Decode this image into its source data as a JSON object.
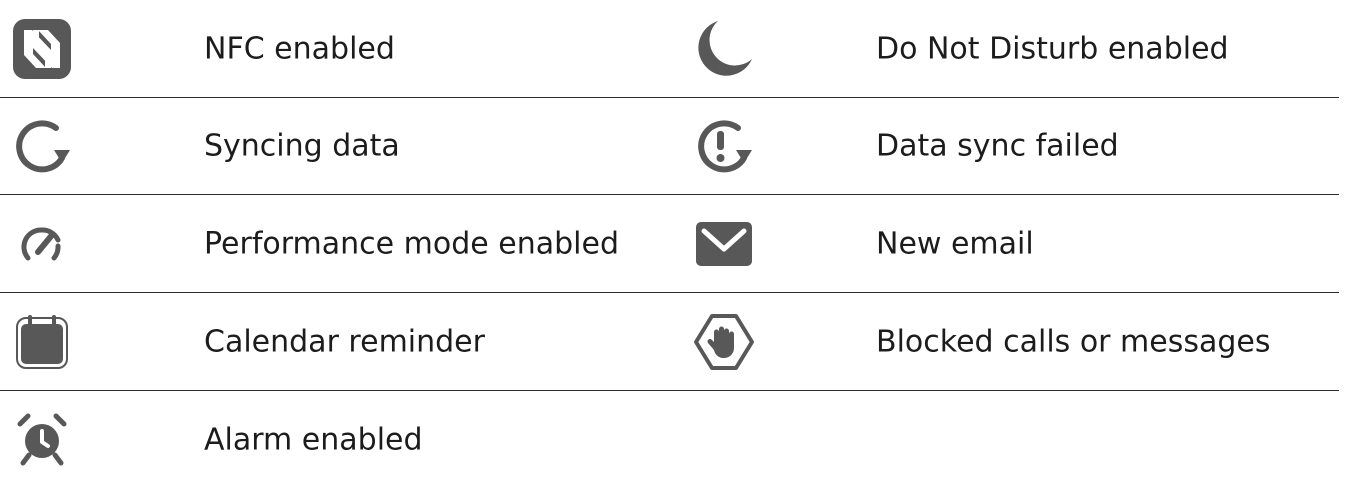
{
  "rows": [
    {
      "left": {
        "icon": "nfc-icon",
        "label": "NFC enabled"
      },
      "right": {
        "icon": "moon-icon",
        "label": "Do Not Disturb enabled"
      }
    },
    {
      "left": {
        "icon": "sync-icon",
        "label": "Syncing data"
      },
      "right": {
        "icon": "sync-failed-icon",
        "label": "Data sync failed"
      }
    },
    {
      "left": {
        "icon": "speedometer-icon",
        "label": "Performance mode enabled"
      },
      "right": {
        "icon": "envelope-icon",
        "label": "New email"
      }
    },
    {
      "left": {
        "icon": "calendar-icon",
        "label": "Calendar reminder"
      },
      "right": {
        "icon": "blocked-hand-icon",
        "label": "Blocked calls or messages"
      }
    },
    {
      "left": {
        "icon": "alarm-clock-icon",
        "label": "Alarm enabled"
      }
    }
  ],
  "colors": {
    "icon": "#585858",
    "text": "#1c1c1c",
    "divider": "#2b2b2b"
  }
}
